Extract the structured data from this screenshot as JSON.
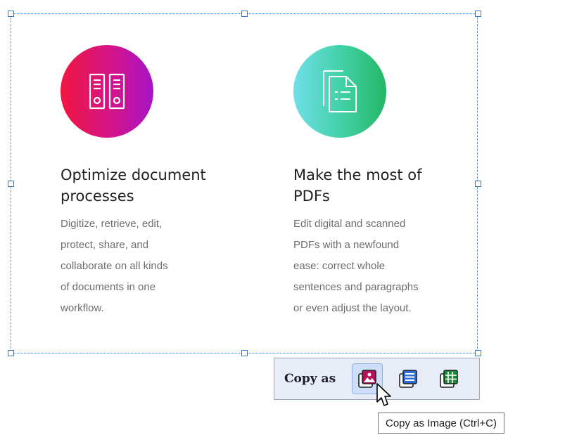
{
  "features": [
    {
      "icon": "binders-icon",
      "title_line1": "Optimize document",
      "title_line2": "processes",
      "description_lines": [
        "Digitize, retrieve, edit,",
        "protect, share, and",
        "collaborate on all kinds",
        "of documents in one",
        "workflow."
      ]
    },
    {
      "icon": "pdf-document-icon",
      "title_line1": "Make the most of",
      "title_line2": "PDFs",
      "description_lines": [
        "Edit digital and scanned",
        "PDFs with a newfound",
        "ease: correct whole",
        "sentences and paragraphs",
        "or even adjust the layout."
      ]
    }
  ],
  "toolbar": {
    "label": "Copy as",
    "buttons": [
      {
        "icon": "copy-as-image-icon",
        "active": true
      },
      {
        "icon": "copy-as-text-icon",
        "active": false
      },
      {
        "icon": "copy-as-table-icon",
        "active": false
      }
    ]
  },
  "tooltip": {
    "text": "Copy as Image (Ctrl+C)"
  },
  "colors": {
    "selection_border": "#3b7fd4",
    "icon_1_gradient": [
      "#f1173f",
      "#d3148a",
      "#a714c7"
    ],
    "icon_2_gradient": [
      "#71dfe8",
      "#3fd0a2",
      "#23b765"
    ],
    "toolbar_bg": "#e7ecf7",
    "image_icon": "#b4105a",
    "text_icon": "#2b6fd6",
    "table_icon": "#1d8a3a"
  }
}
